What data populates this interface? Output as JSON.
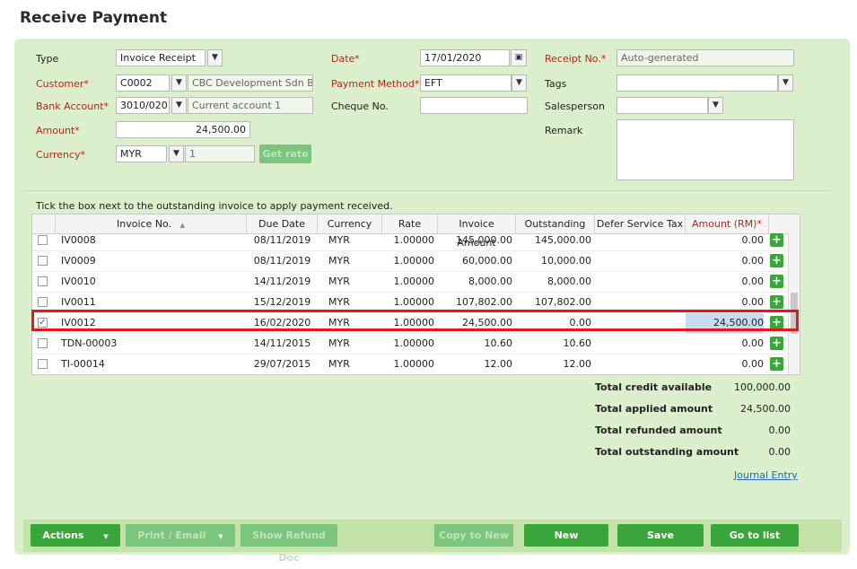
{
  "page": {
    "title": "Receive Payment"
  },
  "form": {
    "type": {
      "label": "Type",
      "value": "Invoice Receipt"
    },
    "customer": {
      "label": "Customer*",
      "code": "C0002",
      "name": "CBC Development Sdn Bhd"
    },
    "bank_account": {
      "label": "Bank Account*",
      "code": "3010/020",
      "name": "Current account 1"
    },
    "amount": {
      "label": "Amount*",
      "value": "24,500.00"
    },
    "currency": {
      "label": "Currency*",
      "value": "MYR",
      "rate": "1",
      "get_rate_label": "Get rate"
    },
    "date": {
      "label": "Date*",
      "value": "17/01/2020"
    },
    "payment_method": {
      "label": "Payment Method*",
      "value": "EFT"
    },
    "cheque_no": {
      "label": "Cheque No.",
      "value": ""
    },
    "receipt_no": {
      "label": "Receipt No.*",
      "value": "Auto-generated"
    },
    "tags": {
      "label": "Tags",
      "value": ""
    },
    "salesperson": {
      "label": "Salesperson",
      "value": ""
    },
    "remark": {
      "label": "Remark",
      "value": ""
    }
  },
  "grid": {
    "hint": "Tick the box next to the outstanding invoice to apply payment received.",
    "columns": [
      "Invoice No.",
      "Due Date",
      "Currency",
      "Rate",
      "Invoice Amount",
      "Outstanding",
      "Defer Service Tax",
      "Amount (RM)*"
    ],
    "sort_indicator": "▲",
    "rows": [
      {
        "checked": false,
        "invoice_no": "IV0008",
        "due_date": "08/11/2019",
        "currency": "MYR",
        "rate": "1.00000",
        "invoice_amount": "145,000.00",
        "outstanding": "145,000.00",
        "defer": "",
        "amount": "0.00"
      },
      {
        "checked": false,
        "invoice_no": "IV0009",
        "due_date": "08/11/2019",
        "currency": "MYR",
        "rate": "1.00000",
        "invoice_amount": "60,000.00",
        "outstanding": "10,000.00",
        "defer": "",
        "amount": "0.00"
      },
      {
        "checked": false,
        "invoice_no": "IV0010",
        "due_date": "14/11/2019",
        "currency": "MYR",
        "rate": "1.00000",
        "invoice_amount": "8,000.00",
        "outstanding": "8,000.00",
        "defer": "",
        "amount": "0.00"
      },
      {
        "checked": false,
        "invoice_no": "IV0011",
        "due_date": "15/12/2019",
        "currency": "MYR",
        "rate": "1.00000",
        "invoice_amount": "107,802.00",
        "outstanding": "107,802.00",
        "defer": "",
        "amount": "0.00"
      },
      {
        "checked": true,
        "invoice_no": "IV0012",
        "due_date": "16/02/2020",
        "currency": "MYR",
        "rate": "1.00000",
        "invoice_amount": "24,500.00",
        "outstanding": "0.00",
        "defer": "",
        "amount": "24,500.00"
      },
      {
        "checked": false,
        "invoice_no": "TDN-00003",
        "due_date": "14/11/2015",
        "currency": "MYR",
        "rate": "1.00000",
        "invoice_amount": "10.60",
        "outstanding": "10.60",
        "defer": "",
        "amount": "0.00"
      },
      {
        "checked": false,
        "invoice_no": "TI-00014",
        "due_date": "29/07/2015",
        "currency": "MYR",
        "rate": "1.00000",
        "invoice_amount": "12.00",
        "outstanding": "12.00",
        "defer": "",
        "amount": "0.00"
      }
    ]
  },
  "totals": {
    "credit_available": {
      "label": "Total credit available",
      "value": "100,000.00"
    },
    "applied": {
      "label": "Total applied amount",
      "value": "24,500.00"
    },
    "refunded": {
      "label": "Total refunded amount",
      "value": "0.00"
    },
    "outstanding": {
      "label": "Total outstanding amount",
      "value": "0.00"
    },
    "journal_entry": "Journal Entry"
  },
  "footer": {
    "actions": "Actions",
    "print_email": "Print / Email",
    "show_refund_doc": "Show Refund Doc",
    "copy_to_new": "Copy to New",
    "new": "New",
    "save": "Save",
    "go_to_list": "Go to list"
  },
  "colors": {
    "accent": "#3aa53a",
    "panel": "#dcefcd",
    "required": "#b5261e",
    "highlight": "#e0191b"
  }
}
